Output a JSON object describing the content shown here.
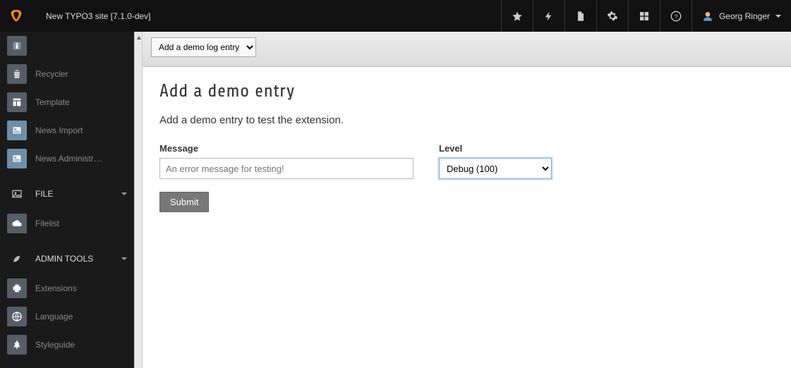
{
  "header": {
    "site_title": "New TYPO3 site [7.1.0-dev]",
    "user_name": "Georg Ringer"
  },
  "sidebar": {
    "items_web": [
      {
        "label": "",
        "icon": "info"
      },
      {
        "label": "Recycler",
        "icon": "trash"
      },
      {
        "label": "Template",
        "icon": "template"
      },
      {
        "label": "News Import",
        "icon": "news"
      },
      {
        "label": "News Administr…",
        "icon": "news"
      }
    ],
    "section_file": "FILE",
    "items_file": [
      {
        "label": "Filelist",
        "icon": "cloud"
      }
    ],
    "section_admin": "ADMIN TOOLS",
    "items_admin": [
      {
        "label": "Extensions",
        "icon": "puzzle"
      },
      {
        "label": "Language",
        "icon": "globe"
      },
      {
        "label": "Styleguide",
        "icon": "tree"
      }
    ]
  },
  "docheader": {
    "func_label": "Add a demo log entry"
  },
  "page": {
    "title": "Add a demo entry",
    "desc": "Add a demo entry to test the extension.",
    "form": {
      "message_label": "Message",
      "message_placeholder": "An error message for testing!",
      "level_label": "Level",
      "level_value": "Debug (100)",
      "submit_label": "Submit"
    }
  }
}
